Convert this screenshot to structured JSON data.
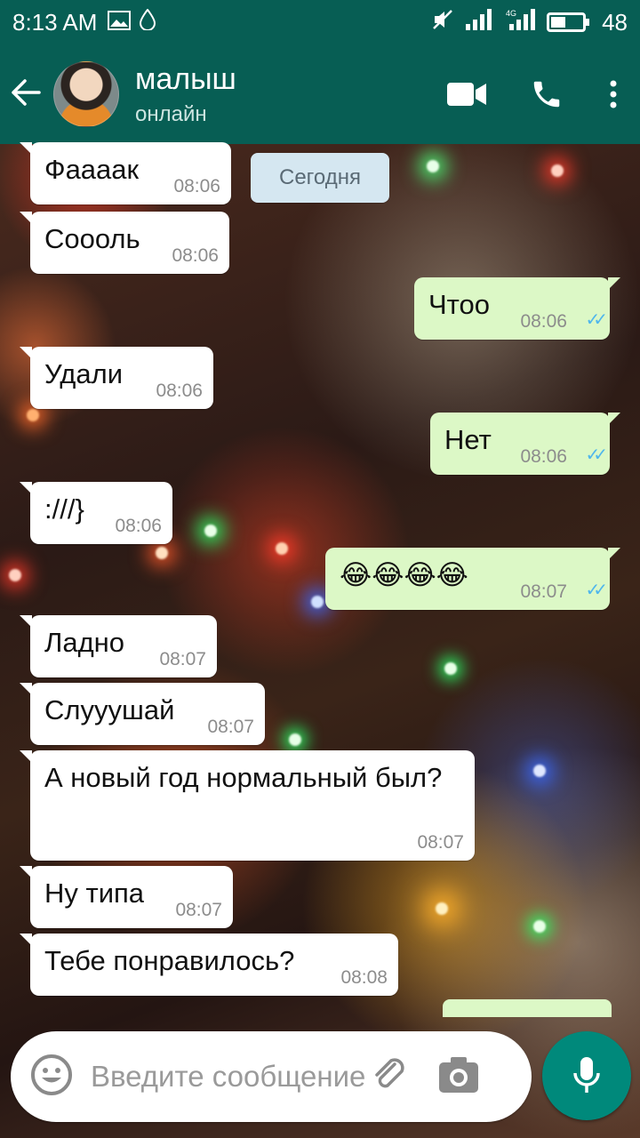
{
  "status_bar": {
    "time": "8:13 AM",
    "battery_level": "48",
    "battery_fill_fraction": 0.48,
    "network": "4G"
  },
  "header": {
    "back_icon": "arrow-left-icon",
    "contact_name": "малыш",
    "contact_status": "онлайн",
    "actions": [
      "video-call-icon",
      "phone-icon",
      "more-vert-icon"
    ]
  },
  "date_chip": "Сегодня",
  "messages": [
    {
      "dir": "in",
      "text": "Фаааак",
      "time": "08:06"
    },
    {
      "dir": "in",
      "text": "Соооль",
      "time": "08:06"
    },
    {
      "dir": "out",
      "text": "Чтоо",
      "time": "08:06",
      "read": true
    },
    {
      "dir": "in",
      "text": "Удали",
      "time": "08:06"
    },
    {
      "dir": "out",
      "text": "Нет",
      "time": "08:06",
      "read": true
    },
    {
      "dir": "in",
      "text": ":///}",
      "time": "08:06"
    },
    {
      "dir": "out",
      "text": "😂😂😂😂",
      "time": "08:07",
      "read": true
    },
    {
      "dir": "in",
      "text": "Ладно",
      "time": "08:07"
    },
    {
      "dir": "in",
      "text": "Слууушай",
      "time": "08:07"
    },
    {
      "dir": "in",
      "text": "А новый год нормальный был?",
      "time": "08:07"
    },
    {
      "dir": "in",
      "text": "Ну типа",
      "time": "08:07"
    },
    {
      "dir": "in",
      "text": "Тебе понравилось?",
      "time": "08:08"
    }
  ],
  "composer": {
    "placeholder": "Введите сообщение",
    "emoji_icon": "emoji-icon",
    "attach_icon": "paperclip-icon",
    "camera_icon": "camera-icon",
    "mic_icon": "microphone-icon"
  },
  "colors": {
    "header": "#075e54",
    "outgoing_bubble": "#dcf8c6",
    "incoming_bubble": "#ffffff",
    "mic_button": "#00897b",
    "read_ticks": "#4fb6ec"
  }
}
